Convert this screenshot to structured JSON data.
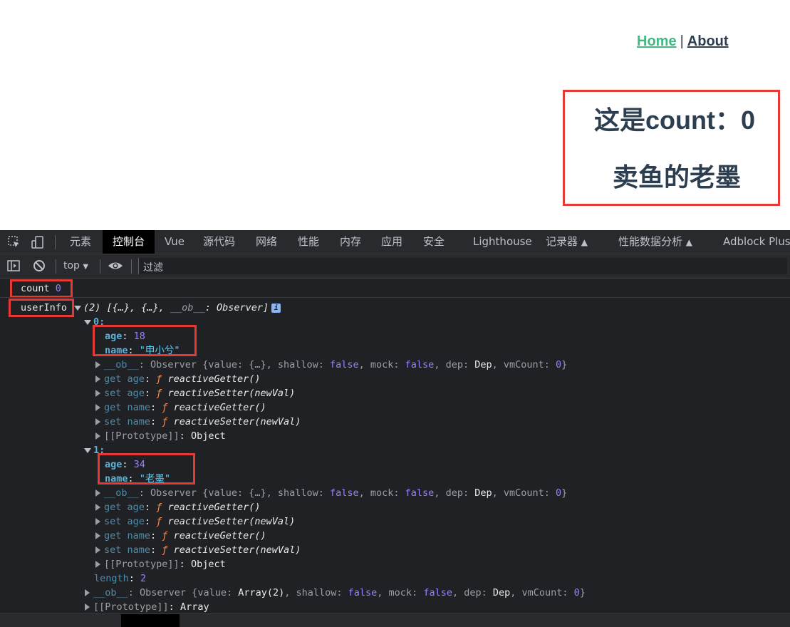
{
  "app": {
    "nav": {
      "home": "Home",
      "separator": "|",
      "about": "About"
    },
    "count_heading": "这是count：0",
    "name_heading": "卖鱼的老墨"
  },
  "devtools": {
    "tabs": [
      "元素",
      "控制台",
      "Vue",
      "源代码",
      "网络",
      "性能",
      "内存",
      "应用",
      "安全",
      "Lighthouse",
      "记录器",
      "性能数据分析",
      "Adblock Plus"
    ],
    "active_tab": "控制台",
    "toolbar": {
      "context": "top",
      "filter_placeholder": "过滤"
    },
    "console": {
      "line1": {
        "label": "count",
        "value": "0"
      },
      "line2": {
        "label": "userInfo",
        "summary_prefix": "(2) [{…}, {…}, ",
        "summary_ob": "__ob__",
        "summary_suffix": ": Observer]"
      },
      "item0": {
        "index": "0:",
        "age_key": "age",
        "age_val": "18",
        "name_key": "name",
        "name_val": "\"申小兮\""
      },
      "item1": {
        "index": "1:",
        "age_key": "age",
        "age_val": "34",
        "name_key": "name",
        "name_val": "\"老墨\""
      },
      "ob_line": {
        "key": "__ob__",
        "text1": ": Observer {value: {…}, shallow: ",
        "shallow": "false",
        "mock_lbl": ", mock: ",
        "mock": "false",
        "dep_lbl": ", dep: ",
        "dep": "Dep",
        "vm_lbl": ", vmCount: ",
        "vm": "0",
        "end": "}"
      },
      "accessors": [
        {
          "k": "get age",
          "fn": "reactiveGetter()"
        },
        {
          "k": "set age",
          "fn": "reactiveSetter(newVal)"
        },
        {
          "k": "get name",
          "fn": "reactiveGetter()"
        },
        {
          "k": "set name",
          "fn": "reactiveSetter(newVal)"
        }
      ],
      "f_glyph": "ƒ",
      "proto_obj": {
        "k": "[[Prototype]]",
        "v": "Object"
      },
      "length": {
        "k": "length",
        "v": "2"
      },
      "arr_ob": {
        "key": "__ob__",
        "text1": ": Observer {value: ",
        "val": "Array(2)",
        "shallow_lbl": ", shallow: ",
        "shallow": "false",
        "mock_lbl": ", mock: ",
        "mock": "false",
        "dep_lbl": ", dep: ",
        "dep": "Dep",
        "vm_lbl": ", vmCount: ",
        "vm": "0",
        "end": "}"
      },
      "proto_arr": {
        "k": "[[Prototype]]",
        "v": "Array"
      }
    }
  },
  "colors": {
    "accent_red": "#e53935",
    "vue_green": "#42b983",
    "devtools_bg": "#202124"
  }
}
